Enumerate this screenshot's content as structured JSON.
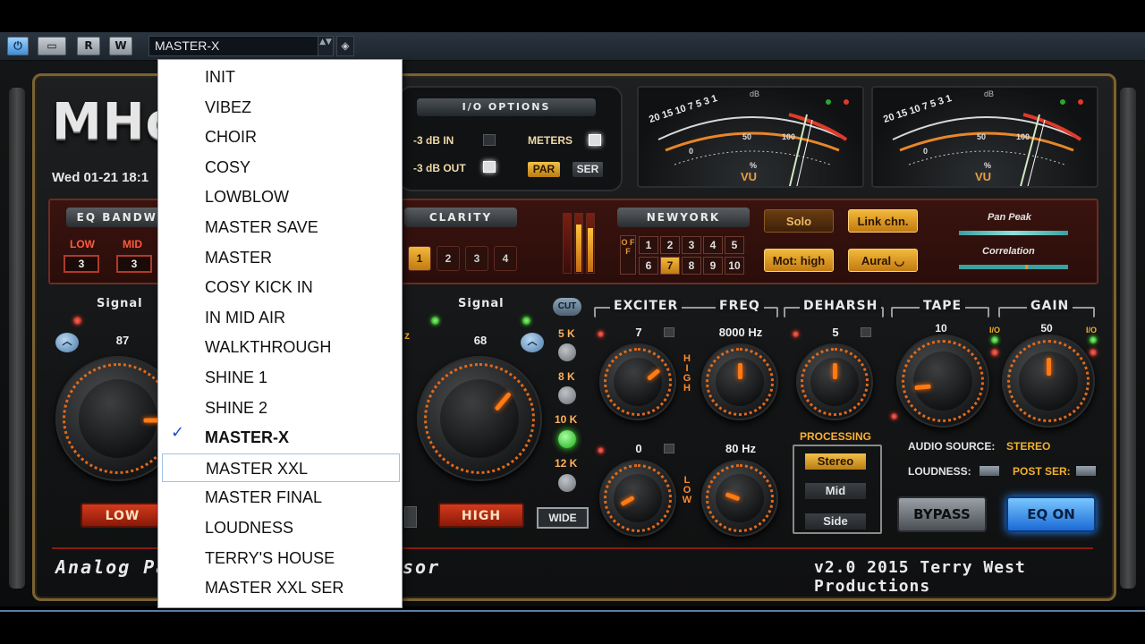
{
  "host": {
    "power_icon": "power-icon",
    "compare_label": "▭",
    "read_label": "R",
    "write_label": "W",
    "preset_value": "MASTER-X",
    "spin_label": "▲▼",
    "random_icon": "dice-icon"
  },
  "plugin": {
    "logo": "MHor.",
    "datetime": "Wed 01-21 18:1",
    "io": {
      "title": "I/O OPTIONS",
      "in_label": "-3 dB IN",
      "out_label": "-3 dB OUT",
      "meters_label": "METERS",
      "par_label": "PAR",
      "ser_label": "SER"
    },
    "vu": {
      "scale_left": "20 15 10 7 5 3 1",
      "scale_left_b": "20 15 10",
      "mark_0": "0",
      "mark_1": "1",
      "mark_50": "50",
      "mark_100": "100",
      "mark_pct": "%",
      "unit": "VU",
      "db": "dB",
      "minus": "−",
      "plus": "+"
    },
    "eq_bandwidth": {
      "title": "EQ BANDWI",
      "low_label": "LOW",
      "mid_label": "MID",
      "low_value": "3",
      "mid_value": "3"
    },
    "clarity": {
      "title": "CLARITY",
      "buttons": [
        "1",
        "2",
        "3",
        "4"
      ]
    },
    "newyork": {
      "title": "NEWYORK",
      "off_label": "O F F",
      "row1": [
        "1",
        "2",
        "3",
        "4",
        "5"
      ],
      "row2": [
        "6",
        "7",
        "8",
        "9",
        "10"
      ]
    },
    "buttons": {
      "solo": "Solo",
      "link": "Link chn.",
      "mot": "Mot: high",
      "aural": "Aural ◡"
    },
    "pan_peak": "Pan Peak",
    "correlation": "Correlation",
    "low_section": {
      "signal_label": "Signal",
      "value": "87",
      "button": "LOW"
    },
    "high_section": {
      "signal_label": "Signal",
      "value": "68",
      "button": "HIGH",
      "up_label": "︿"
    },
    "cut": {
      "badge": "CUT",
      "labels": [
        "5 K",
        "8 K",
        "10 K",
        "12 K"
      ],
      "wide": "WIDE",
      "z_label": "z"
    },
    "exciter": {
      "title": "EXCITER",
      "freq_title": "FREQ",
      "high_value": "7",
      "high_freq": "8000 Hz",
      "low_value": "0",
      "low_freq": "80 Hz",
      "high_vert": "H I G H",
      "low_vert": "L O W"
    },
    "deharsh": {
      "title": "DEHARSH",
      "value": "5"
    },
    "tape": {
      "title": "TAPE",
      "value": "10"
    },
    "gain": {
      "title": "GAIN",
      "value": "50"
    },
    "io_small": "I/O",
    "processing": {
      "title": "PROCESSING",
      "options": [
        "Stereo",
        "Mid",
        "Side"
      ]
    },
    "audio_source_label": "AUDIO SOURCE:",
    "audio_source_value": "STEREO",
    "loudness_label": "LOUDNESS:",
    "post_ser_label": "POST SER:",
    "bypass": "BYPASS",
    "eq_on": "EQ ON",
    "footer_left": "Analog Pa",
    "footer_mid": "sor",
    "footer_right": "v2.0  2015  Terry West Productions"
  },
  "menu": {
    "items": [
      "INIT",
      "VIBEZ",
      "CHOIR",
      "COSY",
      "LOWBLOW",
      "MASTER SAVE",
      "MASTER",
      "COSY KICK IN",
      "IN MID AIR",
      "WALKTHROUGH",
      "SHINE 1",
      "SHINE 2",
      "MASTER-X",
      "MASTER XXL",
      "MASTER FINAL",
      "LOUDNESS",
      "TERRY'S HOUSE",
      "MASTER XXL SER"
    ],
    "selected": "MASTER-X",
    "check": "✓"
  }
}
